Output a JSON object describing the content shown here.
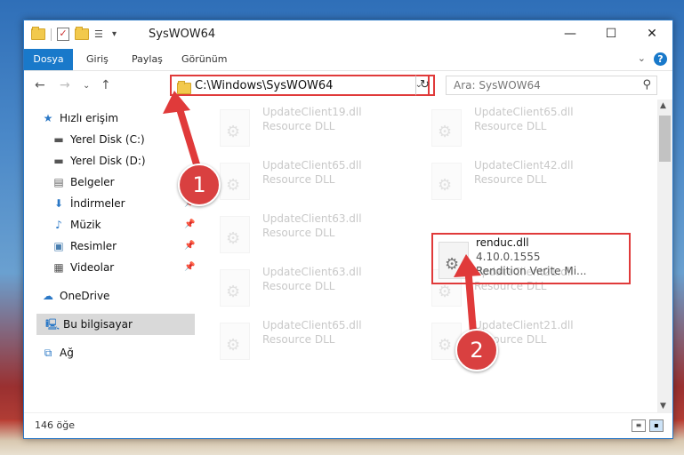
{
  "window": {
    "title": "SysWOW64"
  },
  "ribbon": {
    "tabs": [
      "Dosya",
      "Giriş",
      "Paylaş",
      "Görünüm"
    ],
    "help": "?"
  },
  "nav": {
    "address": "C:\\Windows\\SysWOW64",
    "search_placeholder": "Ara: SysWOW64"
  },
  "sidebar": {
    "quick_access": "Hızlı erişim",
    "items": [
      "Yerel Disk (C:)",
      "Yerel Disk (D:)",
      "Belgeler",
      "İndirmeler",
      "Müzik",
      "Resimler",
      "Videolar"
    ],
    "onedrive": "OneDrive",
    "this_pc": "Bu bilgisayar",
    "network": "Ağ"
  },
  "files": [
    {
      "name": "UpdateClient19.dll",
      "desc": "Resource DLL"
    },
    {
      "name": "UpdateClient65.dll",
      "desc": "Resource DLL"
    },
    {
      "name": "UpdateClient65.dll",
      "desc": "Resource DLL"
    },
    {
      "name": "UpdateClient42.dll",
      "desc": "Resource DLL"
    },
    {
      "name": "UpdateClient63.dll",
      "desc": "Resource DLL"
    },
    {
      "name": "UpdateClient63.dll",
      "desc": "Resource DLL"
    },
    {
      "name": "UpdateClient21.dll",
      "desc": "Resource DLL"
    },
    {
      "name": "UpdateClient65.dll",
      "desc": "Resource DLL"
    },
    {
      "name": "UpdateClient21.dll",
      "desc": "Resource DLL"
    }
  ],
  "selected_file": {
    "name": "renduc.dll",
    "version": "4.10.0.1555",
    "desc": "Rendition Verite Mi..."
  },
  "status": {
    "count": "146 öğe"
  },
  "annotations": {
    "step1": "1",
    "step2": "2",
    "highlight_color": "#e03a3a"
  }
}
